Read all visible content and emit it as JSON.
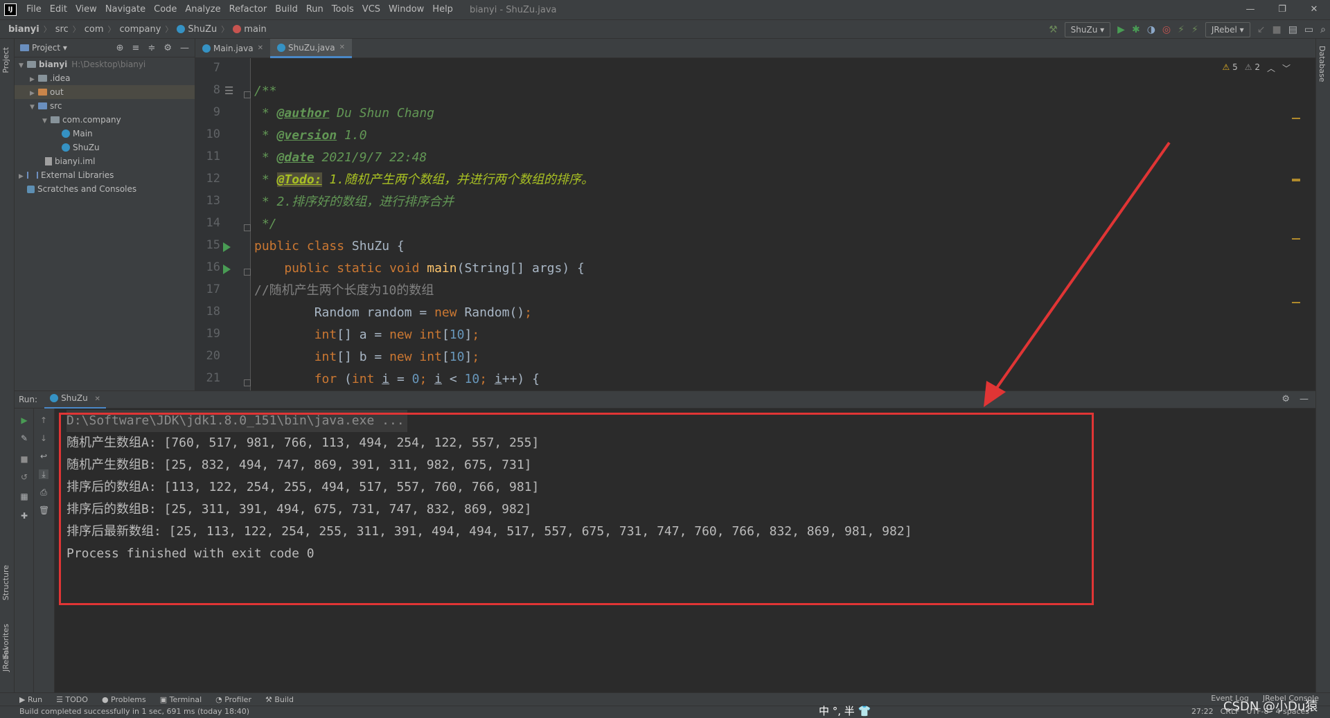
{
  "menubar": {
    "logo": "IJ",
    "items": [
      "File",
      "Edit",
      "View",
      "Navigate",
      "Code",
      "Analyze",
      "Refactor",
      "Build",
      "Run",
      "Tools",
      "VCS",
      "Window",
      "Help"
    ],
    "title": "bianyi - ShuZu.java",
    "controls": [
      "—",
      "❐",
      "✕"
    ]
  },
  "navbar": {
    "crumbs": [
      "bianyi",
      "src",
      "com",
      "company",
      "ShuZu",
      "main"
    ],
    "run_config": "ShuZu ▾",
    "jrebel": "JRebel ▾"
  },
  "left_strip": {
    "project": "Project",
    "structure": "Structure",
    "favorites": "Favorites",
    "jrebel": "JRebel"
  },
  "right_strip": {
    "database": "Database"
  },
  "project": {
    "title": "Project ▾",
    "tree": [
      {
        "label": "bianyi",
        "path": "H:\\Desktop\\bianyi"
      },
      {
        "label": ".idea"
      },
      {
        "label": "out"
      },
      {
        "label": "src"
      },
      {
        "label": "com.company"
      },
      {
        "label": "Main"
      },
      {
        "label": "ShuZu"
      },
      {
        "label": "bianyi.iml"
      },
      {
        "label": "External Libraries"
      },
      {
        "label": "Scratches and Consoles"
      }
    ]
  },
  "tabs": [
    "Main.java",
    "ShuZu.java"
  ],
  "editor": {
    "line_numbers": [
      "7",
      "8",
      "9",
      "10",
      "11",
      "12",
      "13",
      "14",
      "15",
      "16",
      "17",
      "18",
      "19",
      "20",
      "21"
    ],
    "inspections": {
      "warnings": "5",
      "weak_warnings": "2"
    },
    "lines": {
      "l8": "/**",
      "l9_pre": " * ",
      "l9_tag": "@author",
      "l9_text": " Du Shun Chang",
      "l10_pre": " * ",
      "l10_tag": "@version",
      "l10_text": " 1.0",
      "l11_pre": " * ",
      "l11_tag": "@date",
      "l11_text": " 2021/9/7 22:48",
      "l12_pre": " * ",
      "l12_tag": "@Todo:",
      "l12_text": " 1.随机产生两个数组，并进行两个数组的排序。",
      "l13": " * 2.排序好的数组，进行排序合并",
      "l14": " */",
      "l15_kw": "public class ",
      "l15_name": "ShuZu {",
      "l16_kw": "    public static void ",
      "l16_fn": "main",
      "l16_rest": "(String[] args) {",
      "l17": "//随机产生两个长度为10的数组",
      "l18_a": "        Random random = ",
      "l18_kw": "new",
      "l18_b": " Random()",
      "l18_c": ";",
      "l19_kw1": "        int",
      "l19_a": "[] a = ",
      "l19_kw2": "new int",
      "l19_b": "[",
      "l19_n": "10",
      "l19_c": "]",
      "l19_d": ";",
      "l20_kw1": "        int",
      "l20_a": "[] b = ",
      "l20_kw2": "new int",
      "l20_b": "[",
      "l20_n": "10",
      "l20_c": "]",
      "l20_d": ";",
      "l21_kw": "        for",
      "l21_a": " (",
      "l21_kw2": "int ",
      "l21_i1": "i",
      "l21_b": " = ",
      "l21_n0": "0",
      "l21_s1": "; ",
      "l21_i2": "i",
      "l21_c": " < ",
      "l21_n10": "10",
      "l21_s2": "; ",
      "l21_i3": "i",
      "l21_d": "++) {"
    }
  },
  "run": {
    "label": "Run:",
    "tab": "ShuZu",
    "console": [
      "D:\\Software\\JDK\\jdk1.8.0_151\\bin\\java.exe ...",
      "随机产生数组A: [760, 517, 981, 766, 113, 494, 254, 122, 557, 255]",
      "随机产生数组B: [25, 832, 494, 747, 869, 391, 311, 982, 675, 731]",
      "排序后的数组A: [113, 122, 254, 255, 494, 517, 557, 760, 766, 981]",
      "排序后的数组B: [25, 311, 391, 494, 675, 731, 747, 832, 869, 982]",
      "排序后最新数组: [25, 113, 122, 254, 255, 311, 391, 494, 494, 517, 557, 675, 731, 747, 760, 766, 832, 869, 981, 982]",
      "Process finished with exit code 0"
    ]
  },
  "bottom_tools": [
    "▶ Run",
    "☰ TODO",
    "● Problems",
    "▣ Terminal",
    "◔ Profiler",
    "⚒ Build"
  ],
  "bottom_right": [
    "Event Log",
    "JRebel Console"
  ],
  "status": {
    "message": "Build completed successfully in 1 sec, 691 ms (today 18:40)",
    "ime": "中 °, 半 👕",
    "position": "27:22",
    "line_sep": "CRLF",
    "encoding": "UTF-8",
    "indent": "4 spaces",
    "watermark": "CSDN @小Du猿"
  }
}
